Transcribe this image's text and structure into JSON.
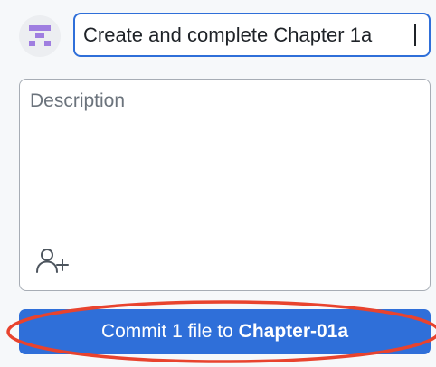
{
  "commit": {
    "avatar_icon": "identicon",
    "summary_value": "Create and complete Chapter 1a",
    "description_placeholder": "Description",
    "coauthor_icon": "add-person-icon",
    "button": {
      "prefix": "Commit 1 file to ",
      "branch": "Chapter-01a"
    },
    "colors": {
      "accent": "#2f6fd9",
      "identicon": "#9f7ee0",
      "annotation": "#e8432e"
    }
  }
}
